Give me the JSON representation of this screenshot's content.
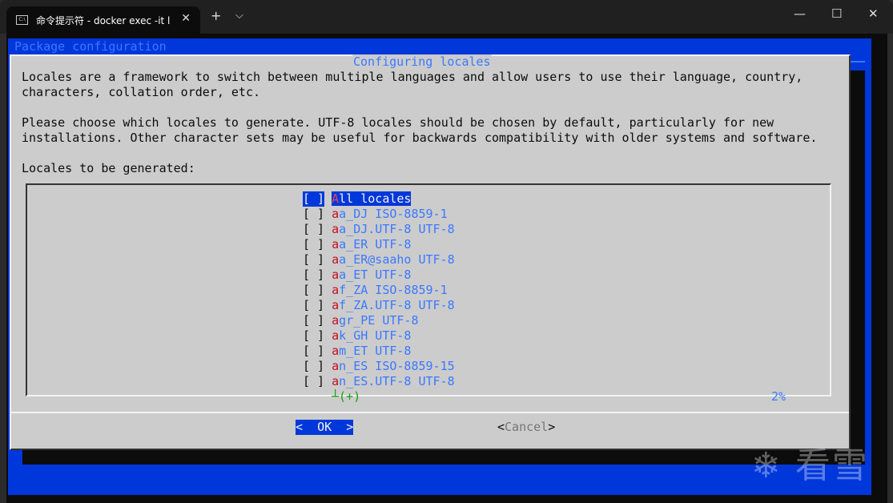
{
  "window": {
    "tab_title": "命令提示符 - docker  exec -it l",
    "tab_icon": "terminal-icon",
    "new_tab": "+",
    "dropdown": "⌵",
    "minimize": "—",
    "maximize": "☐",
    "close": "✕"
  },
  "backtitle": "Package configuration",
  "dialog": {
    "title": "Configuring locales",
    "text_lines": [
      "Locales are a framework to switch between multiple languages and allow users to use their language, country,",
      "characters, collation order, etc.",
      "",
      "Please choose which locales to generate. UTF-8 locales should be chosen by default, particularly for new",
      "installations. Other character sets may be useful for backwards compatibility with older systems and software.",
      "",
      "Locales to be generated:"
    ],
    "items": [
      {
        "checkbox": "[ ]",
        "hotkey": "A",
        "rest": "ll locales",
        "selected": true
      },
      {
        "checkbox": "[ ]",
        "hotkey": "a",
        "rest": "a_DJ ISO-8859-1"
      },
      {
        "checkbox": "[ ]",
        "hotkey": "a",
        "rest": "a_DJ.UTF-8 UTF-8"
      },
      {
        "checkbox": "[ ]",
        "hotkey": "a",
        "rest": "a_ER UTF-8"
      },
      {
        "checkbox": "[ ]",
        "hotkey": "a",
        "rest": "a_ER@saaho UTF-8"
      },
      {
        "checkbox": "[ ]",
        "hotkey": "a",
        "rest": "a_ET UTF-8"
      },
      {
        "checkbox": "[ ]",
        "hotkey": "a",
        "rest": "f_ZA ISO-8859-1"
      },
      {
        "checkbox": "[ ]",
        "hotkey": "a",
        "rest": "f_ZA.UTF-8 UTF-8"
      },
      {
        "checkbox": "[ ]",
        "hotkey": "a",
        "rest": "gr_PE UTF-8"
      },
      {
        "checkbox": "[ ]",
        "hotkey": "a",
        "rest": "k_GH UTF-8"
      },
      {
        "checkbox": "[ ]",
        "hotkey": "a",
        "rest": "m_ET UTF-8"
      },
      {
        "checkbox": "[ ]",
        "hotkey": "a",
        "rest": "n_ES ISO-8859-15"
      },
      {
        "checkbox": "[ ]",
        "hotkey": "a",
        "rest": "n_ES.UTF-8 UTF-8"
      }
    ],
    "more_indicator": "┴(+)",
    "scroll_percent": "2%",
    "ok_label": "<  OK  >",
    "cancel_label": "Cancel"
  },
  "watermark": "❄ 看雪",
  "colors": {
    "blue": "#0037da",
    "accent": "#3b78ff",
    "hotkey": "#c50f1f",
    "dialog": "#cccccc",
    "green": "#13a10e"
  }
}
